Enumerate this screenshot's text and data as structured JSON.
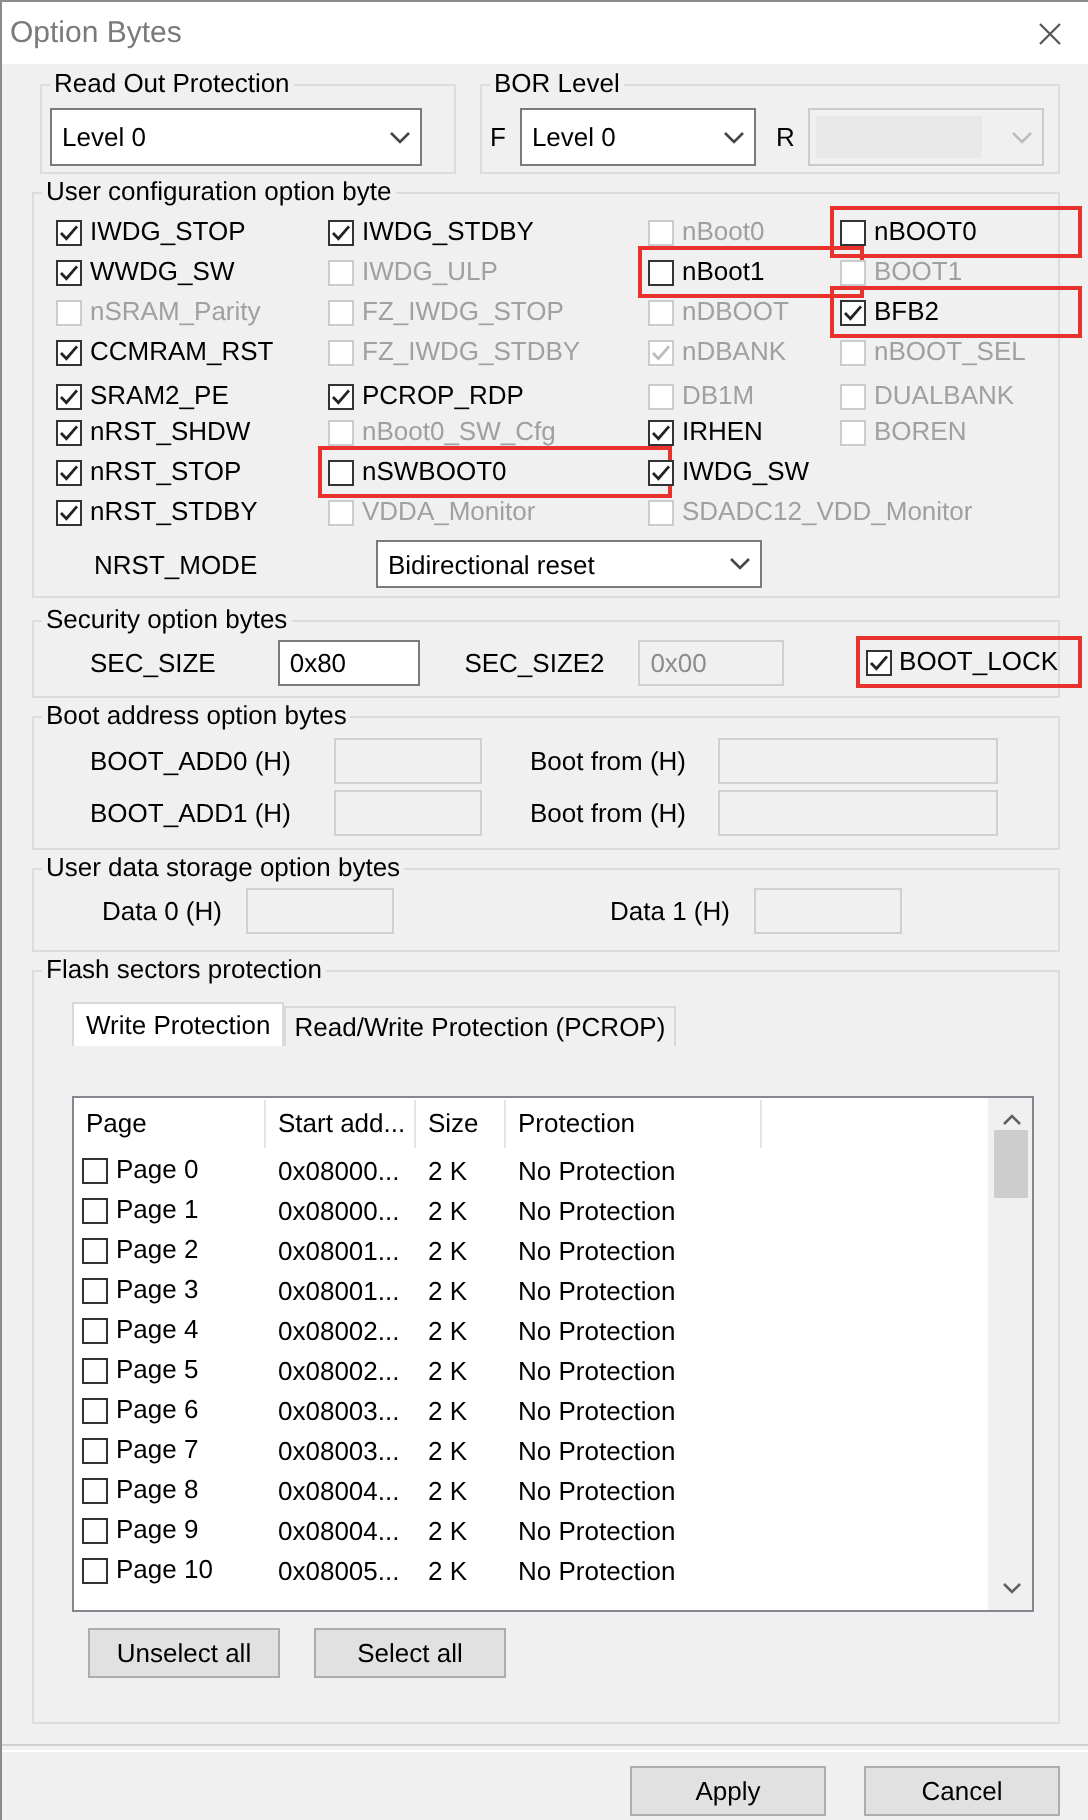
{
  "window": {
    "title": "Option Bytes"
  },
  "read_out_protection": {
    "title": "Read Out Protection",
    "dropdown": {
      "value": "Level 0",
      "disabled": false
    }
  },
  "bor_level": {
    "title": "BOR Level",
    "f_label": "F",
    "f_dropdown": {
      "value": "Level 0",
      "disabled": false
    },
    "r_label": "R",
    "r_dropdown": {
      "disabled": true
    }
  },
  "user_config": {
    "title": "User configuration option byte",
    "rows": [
      [
        {
          "label": "IWDG_STOP",
          "checked": true,
          "disabled": false,
          "highlighted": false
        },
        {
          "label": "IWDG_STDBY",
          "checked": true,
          "disabled": false,
          "highlighted": false
        },
        {
          "label": "nBoot0",
          "checked": false,
          "disabled": true,
          "highlighted": false
        },
        {
          "label": "nBOOT0",
          "checked": false,
          "disabled": false,
          "highlighted": true
        }
      ],
      [
        {
          "label": "WWDG_SW",
          "checked": true,
          "disabled": false,
          "highlighted": false
        },
        {
          "label": "IWDG_ULP",
          "checked": false,
          "disabled": true,
          "highlighted": false
        },
        {
          "label": "nBoot1",
          "checked": false,
          "disabled": false,
          "highlighted": true
        },
        {
          "label": "BOOT1",
          "checked": false,
          "disabled": true,
          "highlighted": false
        }
      ],
      [
        {
          "label": "nSRAM_Parity",
          "checked": false,
          "disabled": true,
          "highlighted": false
        },
        {
          "label": "FZ_IWDG_STOP",
          "checked": false,
          "disabled": true,
          "highlighted": false
        },
        {
          "label": "nDBOOT",
          "checked": false,
          "disabled": true,
          "highlighted": false
        },
        {
          "label": "BFB2",
          "checked": true,
          "disabled": false,
          "highlighted": true
        }
      ],
      [
        {
          "label": "CCMRAM_RST",
          "checked": true,
          "disabled": false,
          "highlighted": false
        },
        {
          "label": "FZ_IWDG_STDBY",
          "checked": false,
          "disabled": true,
          "highlighted": false
        },
        {
          "label": "nDBANK",
          "checked": true,
          "disabled": true,
          "highlighted": false
        },
        {
          "label": "nBOOT_SEL",
          "checked": false,
          "disabled": true,
          "highlighted": false
        }
      ],
      [
        {
          "label": "SRAM2_PE",
          "checked": true,
          "disabled": false,
          "highlighted": false
        },
        {
          "label": "PCROP_RDP",
          "checked": true,
          "disabled": false,
          "highlighted": false
        },
        {
          "label": "DB1M",
          "checked": false,
          "disabled": true,
          "highlighted": false
        },
        {
          "label": "DUALBANK",
          "checked": false,
          "disabled": true,
          "highlighted": false
        }
      ],
      [
        {
          "label": "nRST_SHDW",
          "checked": true,
          "disabled": false,
          "highlighted": false
        },
        {
          "label": "nBoot0_SW_Cfg",
          "checked": false,
          "disabled": true,
          "highlighted": false
        },
        {
          "label": "IRHEN",
          "checked": true,
          "disabled": false,
          "highlighted": false
        },
        {
          "label": "BOREN",
          "checked": false,
          "disabled": true,
          "highlighted": false
        }
      ],
      [
        {
          "label": "nRST_STOP",
          "checked": true,
          "disabled": false,
          "highlighted": false
        },
        {
          "label": "nSWBOOT0",
          "checked": false,
          "disabled": false,
          "highlighted": true
        },
        {
          "label": "IWDG_SW",
          "checked": true,
          "disabled": false,
          "highlighted": false
        }
      ],
      [
        {
          "label": "nRST_STDBY",
          "checked": true,
          "disabled": false,
          "highlighted": false
        },
        {
          "label": "VDDA_Monitor",
          "checked": false,
          "disabled": true,
          "highlighted": false
        },
        {
          "label": "SDADC12_VDD_Monitor",
          "checked": false,
          "disabled": true,
          "highlighted": false
        }
      ]
    ],
    "nrst_mode": {
      "label": "NRST_MODE",
      "dropdown": {
        "value": "Bidirectional reset",
        "disabled": false
      }
    }
  },
  "security": {
    "title": "Security option bytes",
    "sec_size": {
      "label": "SEC_SIZE",
      "value": "0x80",
      "disabled": false
    },
    "sec_size2": {
      "label": "SEC_SIZE2",
      "value": "0x00",
      "disabled": true
    },
    "boot_lock": {
      "label": "BOOT_LOCK",
      "checked": true,
      "disabled": false,
      "highlighted": true
    }
  },
  "boot_address": {
    "title": "Boot address option bytes",
    "rows": [
      {
        "label": "BOOT_ADD0 (H)",
        "disabled": true,
        "from_label": "Boot from (H)",
        "from_disabled": true
      },
      {
        "label": "BOOT_ADD1 (H)",
        "disabled": true,
        "from_label": "Boot from (H)",
        "from_disabled": true
      }
    ]
  },
  "user_data": {
    "title": "User data storage option bytes",
    "fields": [
      {
        "label": "Data 0 (H)",
        "disabled": true
      },
      {
        "label": "Data 1 (H)",
        "disabled": true
      }
    ]
  },
  "flash_protection": {
    "title": "Flash sectors protection",
    "tabs": [
      {
        "label": "Write Protection",
        "selected": true
      },
      {
        "label": "Read/Write Protection (PCROP)",
        "selected": false
      }
    ],
    "table": {
      "columns": [
        "Page",
        "Start add...",
        "Size",
        "Protection"
      ],
      "rows": [
        {
          "page": "Page 0",
          "start": "0x08000...",
          "size": "2 K",
          "protection": "No Protection",
          "checked": false
        },
        {
          "page": "Page 1",
          "start": "0x08000...",
          "size": "2 K",
          "protection": "No Protection",
          "checked": false
        },
        {
          "page": "Page 2",
          "start": "0x08001...",
          "size": "2 K",
          "protection": "No Protection",
          "checked": false
        },
        {
          "page": "Page 3",
          "start": "0x08001...",
          "size": "2 K",
          "protection": "No Protection",
          "checked": false
        },
        {
          "page": "Page 4",
          "start": "0x08002...",
          "size": "2 K",
          "protection": "No Protection",
          "checked": false
        },
        {
          "page": "Page 5",
          "start": "0x08002...",
          "size": "2 K",
          "protection": "No Protection",
          "checked": false
        },
        {
          "page": "Page 6",
          "start": "0x08003...",
          "size": "2 K",
          "protection": "No Protection",
          "checked": false
        },
        {
          "page": "Page 7",
          "start": "0x08003...",
          "size": "2 K",
          "protection": "No Protection",
          "checked": false
        },
        {
          "page": "Page 8",
          "start": "0x08004...",
          "size": "2 K",
          "protection": "No Protection",
          "checked": false
        },
        {
          "page": "Page 9",
          "start": "0x08004...",
          "size": "2 K",
          "protection": "No Protection",
          "checked": false
        },
        {
          "page": "Page 10",
          "start": "0x08005...",
          "size": "2 K",
          "protection": "No Protection",
          "checked": false
        }
      ]
    },
    "buttons": [
      "Unselect all",
      "Select all"
    ]
  },
  "buttons": [
    "Apply",
    "Cancel"
  ]
}
